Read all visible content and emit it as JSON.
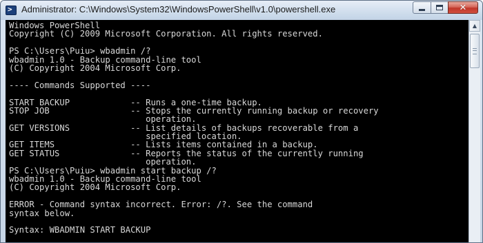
{
  "window": {
    "title": "Administrator: C:\\Windows\\System32\\WindowsPowerShell\\v1.0\\powershell.exe",
    "app_icon": "powershell-icon",
    "controls": {
      "minimize": "minimize-icon",
      "maximize": "maximize-icon",
      "close": "close-icon",
      "close_glyph": "✕"
    }
  },
  "console": {
    "background": "#000000",
    "foreground": "#d8d8d8",
    "lines": [
      "Windows PowerShell",
      "Copyright (C) 2009 Microsoft Corporation. All rights reserved.",
      "",
      "PS C:\\Users\\Puiu> wbadmin /?",
      "wbadmin 1.0 - Backup command-line tool",
      "(C) Copyright 2004 Microsoft Corp.",
      "",
      "---- Commands Supported ----",
      "",
      "START BACKUP            -- Runs a one-time backup.",
      "STOP JOB                -- Stops the currently running backup or recovery",
      "                           operation.",
      "GET VERSIONS            -- List details of backups recoverable from a",
      "                           specified location.",
      "GET ITEMS               -- Lists items contained in a backup.",
      "GET STATUS              -- Reports the status of the currently running",
      "                           operation.",
      "PS C:\\Users\\Puiu> wbadmin start backup /?",
      "wbadmin 1.0 - Backup command-line tool",
      "(C) Copyright 2004 Microsoft Corp.",
      "",
      "ERROR - Command syntax incorrect. Error: /?. See the command",
      "syntax below.",
      "",
      "Syntax: WBADMIN START BACKUP"
    ]
  },
  "scrollbar": {
    "up_icon": "scroll-up-arrow-icon",
    "up_glyph": "▲"
  }
}
